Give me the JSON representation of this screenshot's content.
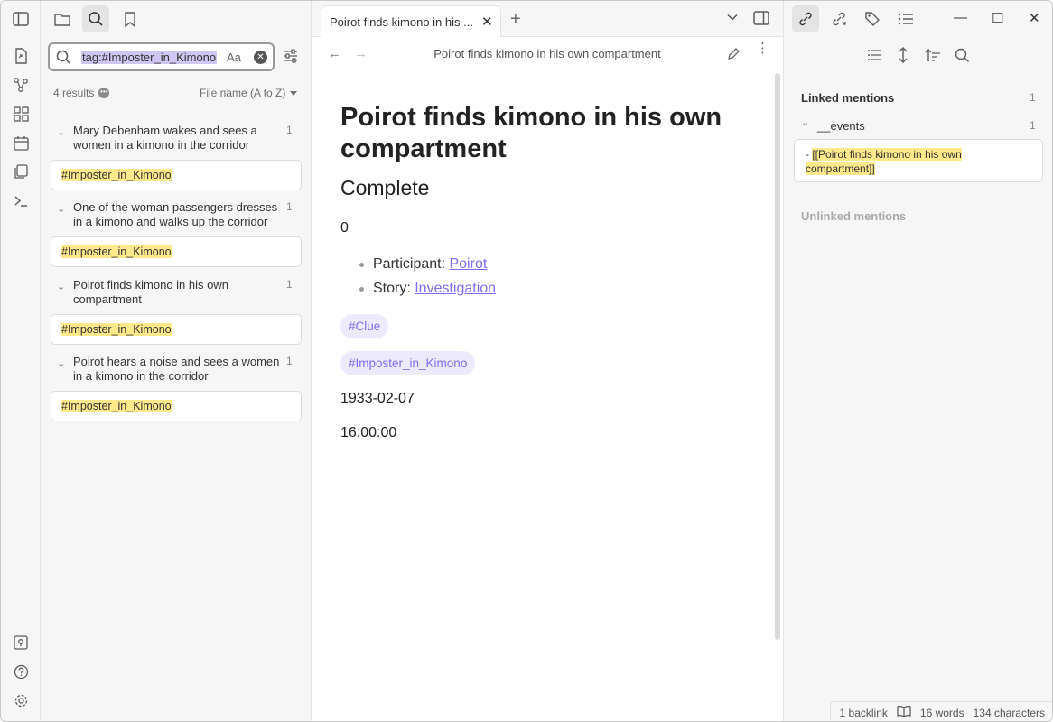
{
  "search": {
    "query": "tag:#Imposter_in_Kimono",
    "match_case_label": "Aa",
    "results_count": "4 results",
    "sort_label": "File name (A to Z)"
  },
  "results": [
    {
      "title": "Mary Debenham wakes and sees a women in a kimono in the corridor",
      "count": "1",
      "match": "#Imposter_in_Kimono"
    },
    {
      "title": "One of the woman passengers dresses in a kimono and walks up the corridor",
      "count": "1",
      "match": "#Imposter_in_Kimono"
    },
    {
      "title": "Poirot finds kimono in his own compartment",
      "count": "1",
      "match": "#Imposter_in_Kimono"
    },
    {
      "title": "Poirot hears a noise and sees a women in a kimono in the corridor",
      "count": "1",
      "match": "#Imposter_in_Kimono"
    }
  ],
  "tab": {
    "label": "Poirot finds kimono in his ..."
  },
  "editor": {
    "nav_title": "Poirot finds kimono in his own compartment",
    "h1": "Poirot finds kimono in his own compartment",
    "h2": "Complete",
    "zero": "0",
    "participant_label": "Participant: ",
    "participant_link": "Poirot",
    "story_label": "Story: ",
    "story_link": "Investigation",
    "tag1": "#Clue",
    "tag2": "#Imposter_in_Kimono",
    "date": "1933-02-07",
    "time": "16:00:00"
  },
  "backlinks": {
    "linked_title": "Linked mentions",
    "linked_count": "1",
    "folder": "__events",
    "folder_count": "1",
    "mention_prefix": "- ",
    "mention_text": "[[Poirot finds kimono in his own compartment]]",
    "unlinked_title": "Unlinked mentions"
  },
  "status": {
    "backlinks": "1 backlink",
    "words": "16 words",
    "chars": "134 characters"
  },
  "colors": {
    "accent": "#7f6df2",
    "highlight": "#ffe98a",
    "query_highlight": "#cfc6f3"
  }
}
